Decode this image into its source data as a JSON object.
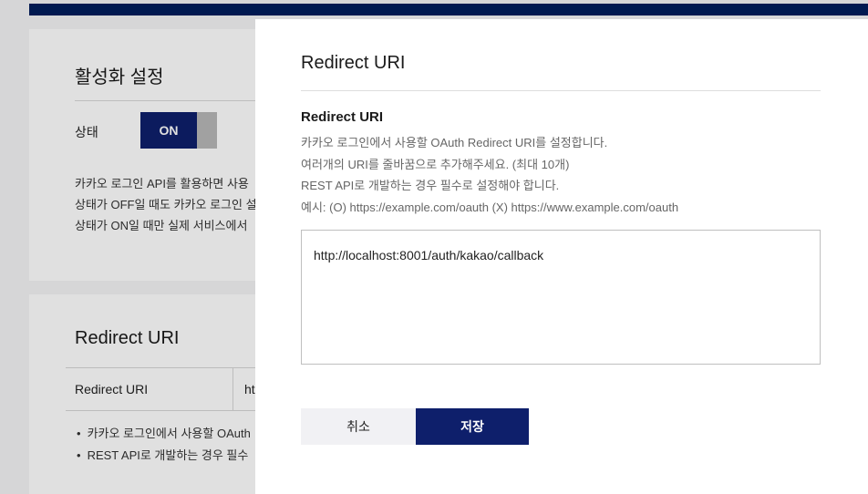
{
  "background": {
    "activation": {
      "title": "활성화 설정",
      "status_label": "상태",
      "toggle_label": "ON",
      "desc_lines": [
        "카카오 로그인 API를 활용하면 사용",
        "상태가 OFF일 때도 카카오 로그인 설",
        "상태가 ON일 때만 실제 서비스에서"
      ]
    },
    "redirect": {
      "title": "Redirect URI",
      "row_label": "Redirect URI",
      "row_value": "ht",
      "bullets": [
        "카카오 로그인에서 사용할 OAuth",
        "REST API로 개발하는 경우 필수"
      ]
    }
  },
  "modal": {
    "title": "Redirect URI",
    "section_title": "Redirect URI",
    "desc_lines": [
      "카카오 로그인에서 사용할 OAuth Redirect URI를 설정합니다.",
      "여러개의 URI를 줄바꿈으로 추가해주세요. (최대 10개)",
      "REST API로 개발하는 경우 필수로 설정해야 합니다.",
      "예시: (O) https://example.com/oauth (X) https://www.example.com/oauth"
    ],
    "textarea_value": "http://localhost:8001/auth/kakao/callback",
    "cancel_label": "취소",
    "save_label": "저장"
  },
  "colors": {
    "primary": "#0e1f6b",
    "top_bar": "#001d5c",
    "toggle_off": "#b8b8b8",
    "cancel_bg": "#f1f1f4"
  }
}
